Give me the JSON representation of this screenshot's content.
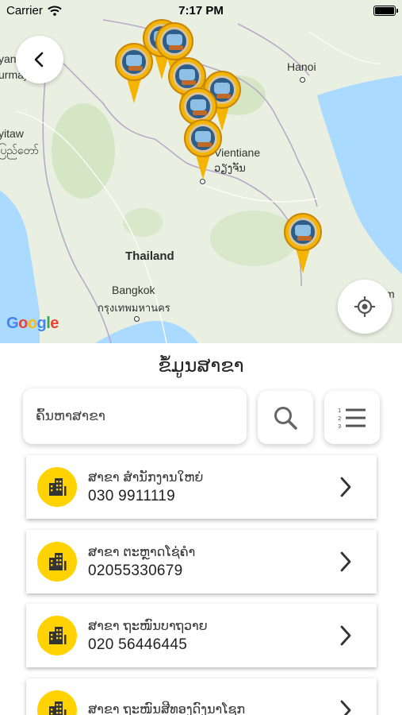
{
  "status_bar": {
    "carrier": "Carrier",
    "time": "7:17 PM"
  },
  "map": {
    "labels": {
      "hanoi": "Hanoi",
      "vientiane": "Vientiane",
      "vientiane_thai": "ວຽງຈັນ",
      "thailand": "Thailand",
      "bangkok": "Bangkok",
      "bangkok_thai": "กรุงเทพมหานคร",
      "edge_myanmar_top": "yan",
      "edge_myanmar_bottom": "urma)",
      "edge_naypyitaw": "yitaw",
      "edge_naypyitaw_script": "ပြည်တော်",
      "edge_m_right": "m"
    },
    "attribution": "Google",
    "pin_color": "#f4b400"
  },
  "panel": {
    "title": "ຂໍ້ມູນສາຂາ",
    "search_placeholder": "ຄົ້ນຫາສາຂາ",
    "branches": [
      {
        "name": "ສາຂາ ສໍານັກງານໃຫຍ່",
        "phone": "030 9911119"
      },
      {
        "name": "ສາຂາ ຕະຫຼາດໂຊ່ຄໍາ",
        "phone": "02055330679"
      },
      {
        "name": "ສາຂາ ຖະໜົນບາຖວາຍ",
        "phone": "020 56446445"
      },
      {
        "name": "ສາຂາ ຖະໜົນສີທອງດົງນາໂຊກ",
        "phone": ""
      }
    ]
  },
  "colors": {
    "accent": "#ffd200",
    "icon": "#333333"
  },
  "icons": {
    "back": "chevron-left-icon",
    "locate": "my-location-icon",
    "search": "search-icon",
    "list": "numbered-list-icon",
    "branch": "building-icon",
    "row": "chevron-right-icon"
  }
}
